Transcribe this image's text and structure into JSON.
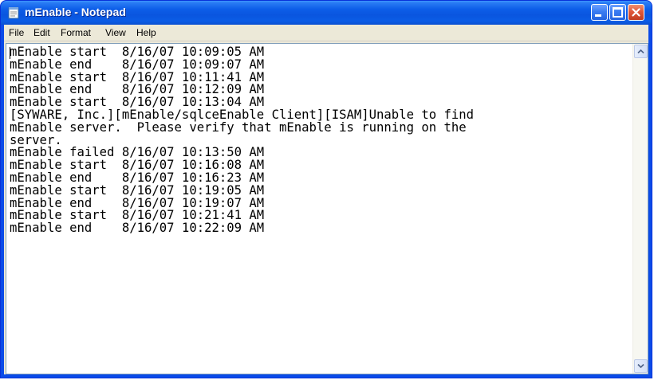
{
  "window": {
    "title": "mEnable - Notepad"
  },
  "menu": {
    "file": "File",
    "edit": "Edit",
    "format": "Format",
    "view": "View",
    "help": "Help"
  },
  "document": {
    "text": "mEnable start  8/16/07 10:09:05 AM\nmEnable end    8/16/07 10:09:07 AM\nmEnable start  8/16/07 10:11:41 AM\nmEnable end    8/16/07 10:12:09 AM\nmEnable start  8/16/07 10:13:04 AM\n[SYWARE, Inc.][mEnable/sqlceEnable Client][ISAM]Unable to find\nmEnable server.  Please verify that mEnable is running on the\nserver.\nmEnable failed 8/16/07 10:13:50 AM\nmEnable start  8/16/07 10:16:08 AM\nmEnable end    8/16/07 10:16:23 AM\nmEnable start  8/16/07 10:19:05 AM\nmEnable end    8/16/07 10:19:07 AM\nmEnable start  8/16/07 10:21:41 AM\nmEnable end    8/16/07 10:22:09 AM"
  },
  "icons": {
    "app": "notepad-icon",
    "minimize": "minimize-icon",
    "maximize": "maximize-icon",
    "close": "close-icon",
    "scroll_up": "chevron-up-icon",
    "scroll_down": "chevron-down-icon"
  },
  "colors": {
    "titlebar": "#0a55df",
    "close_button": "#e0583a",
    "frame": "#ece9d8",
    "editor_border": "#7f9db9"
  }
}
